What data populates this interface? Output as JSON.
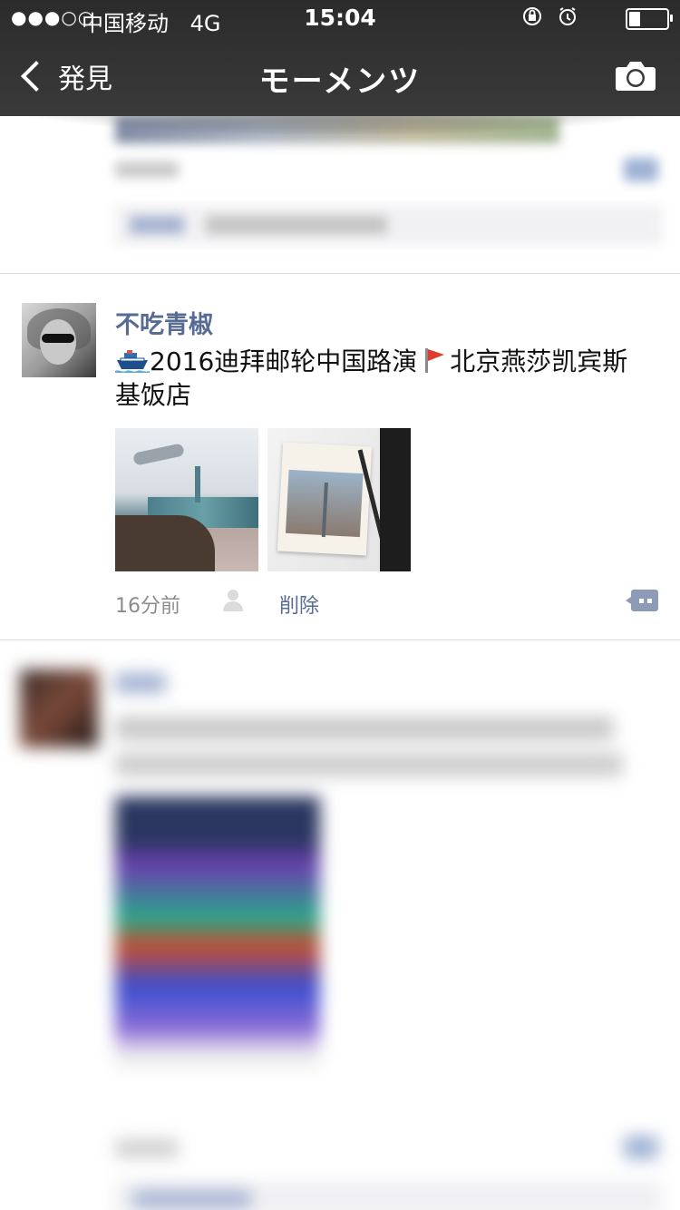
{
  "status_bar": {
    "signal": "●●●○○",
    "carrier": "中国移动",
    "network": "4G",
    "time": "15:04",
    "battery_level": 0.3
  },
  "nav": {
    "back_label": "発見",
    "title": "モーメンツ",
    "camera_icon": "camera-icon"
  },
  "post": {
    "username": "不吃青椒",
    "text_main": "2016迪拜邮轮中国路演",
    "text_tail": "北京燕莎凯宾斯基饭店",
    "emoji_ship": "ship-icon",
    "emoji_flag": "red-flag-icon",
    "images": [
      {
        "name": "airport-skyline-photo"
      },
      {
        "name": "dubai-guidebook-photo"
      }
    ],
    "time_ago": "16分前",
    "delete_label": "削除",
    "accent_color": "#576b95"
  }
}
